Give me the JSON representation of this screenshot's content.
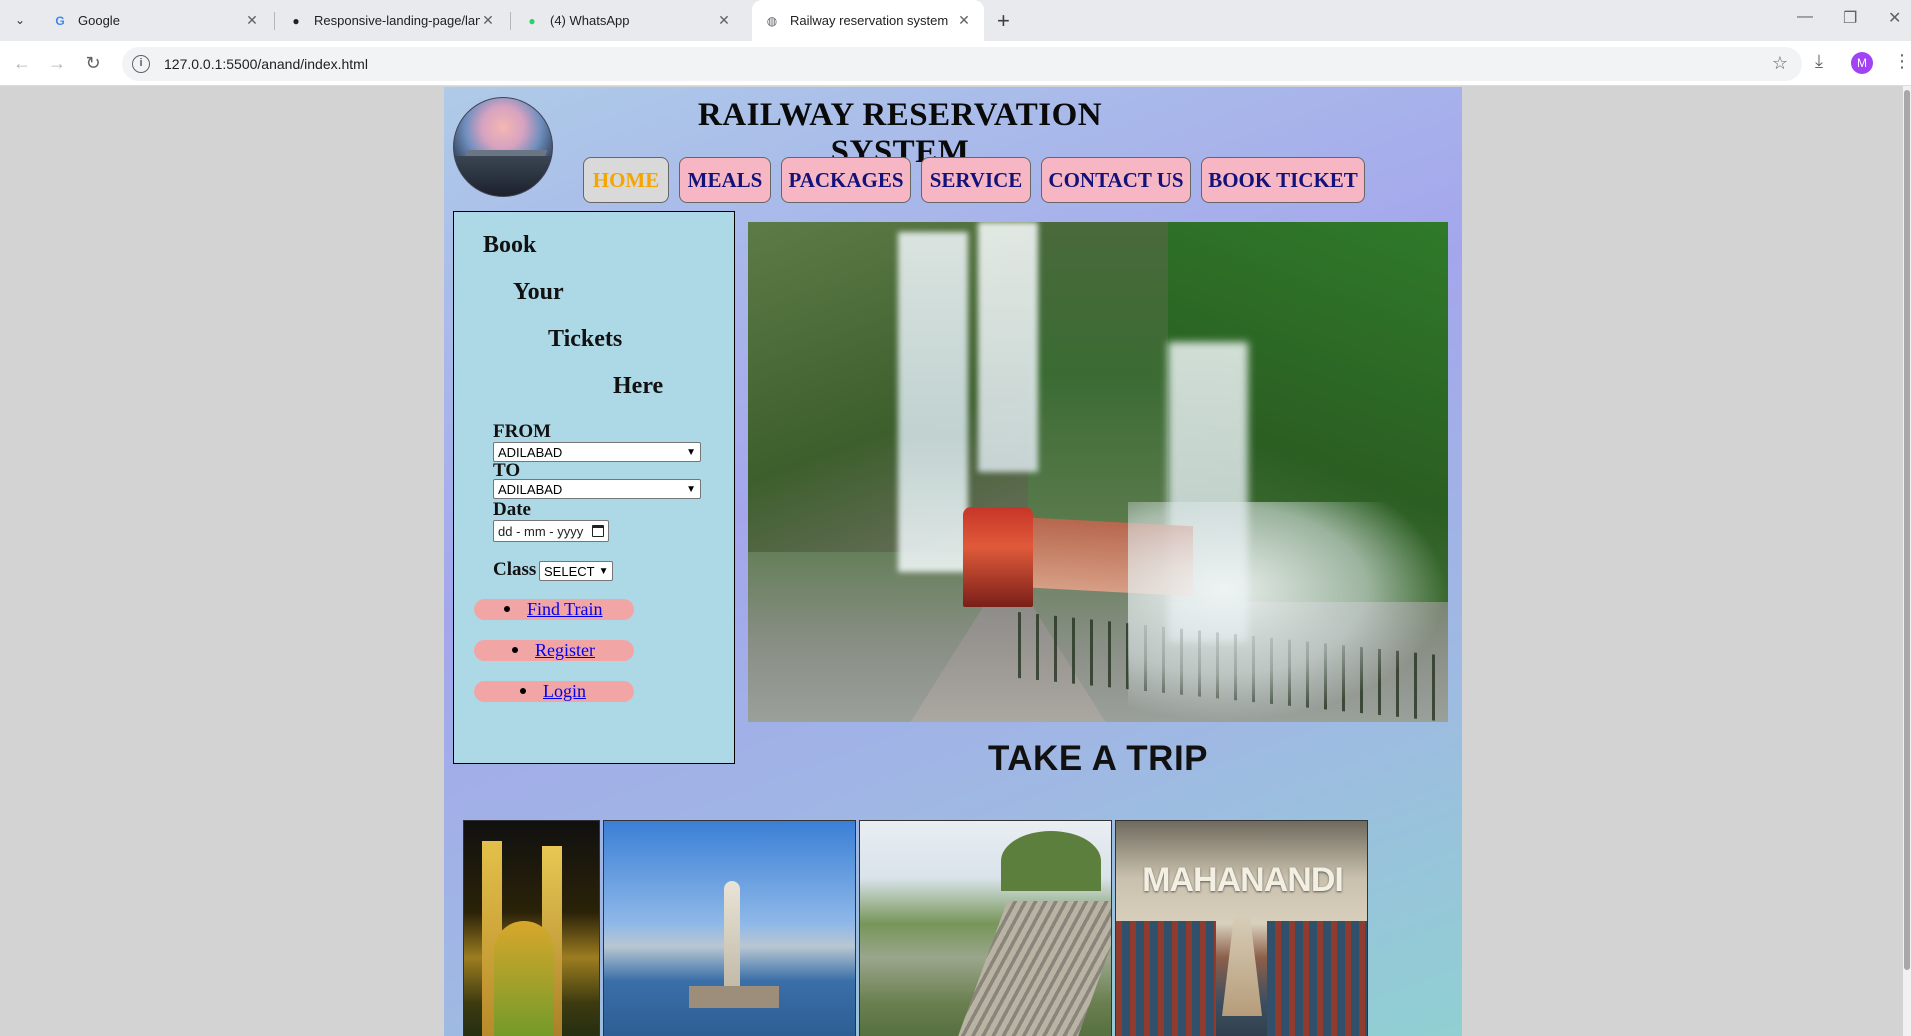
{
  "browser": {
    "tabs": [
      {
        "title": "Google",
        "favicon": "google-g-icon",
        "active": false
      },
      {
        "title": "Responsive-landing-page/landi",
        "favicon": "github-icon",
        "active": false
      },
      {
        "title": "(4) WhatsApp",
        "favicon": "whatsapp-icon",
        "active": false
      },
      {
        "title": "Railway reservation system",
        "favicon": "globe-icon",
        "active": true
      }
    ],
    "url": "127.0.0.1:5500/anand/index.html",
    "profile_initial": "M"
  },
  "site": {
    "title": "RAILWAY RESERVATION SYSTEM",
    "nav": [
      {
        "label": "HOME",
        "active": true
      },
      {
        "label": "MEALS",
        "active": false
      },
      {
        "label": "PACKAGES",
        "active": false
      },
      {
        "label": "SERVICE",
        "active": false
      },
      {
        "label": "CONTACT US",
        "active": false
      },
      {
        "label": "BOOK TICKET",
        "active": false
      }
    ]
  },
  "booking": {
    "heading_words": [
      "Book",
      "Your",
      "Tickets",
      "Here"
    ],
    "from_label": "FROM",
    "from_value": "ADILABAD",
    "to_label": "TO",
    "to_value": "ADILABAD",
    "date_label": "Date",
    "date_placeholder": "dd - mm - yyyy",
    "class_label": "Class",
    "class_value": "SELECT",
    "links": [
      "Find Train",
      "Register",
      "Login"
    ]
  },
  "main": {
    "trip_heading": "TAKE A TRIP",
    "gallery_caption_4": "MAHANANDI"
  },
  "colors": {
    "nav_button_bg": "#f7b6c3",
    "nav_text": "#12127a",
    "nav_active_text": "#f5a400",
    "booking_bg": "#add8e6",
    "pill_bg": "#f2a5a5",
    "link": "#0000ee"
  }
}
